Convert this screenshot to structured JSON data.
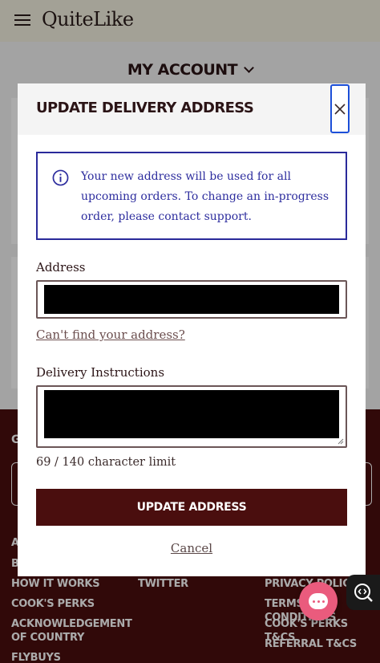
{
  "header": {
    "logo": "QuiteLike"
  },
  "account": {
    "title": "MY ACCOUNT"
  },
  "footer": {
    "newsletter_heading": "G",
    "col1": [
      "A",
      "B",
      "HOW IT WORKS",
      "COOK'S PERKS",
      "ACKNOWLEDGEMENT",
      "OF COUNTRY",
      "FLYBUYS"
    ],
    "col2": [
      "TWITTER"
    ],
    "col3": [
      "PRIVACY POLICY",
      "TERMS & CONDITIONS",
      "COOK'S PERKS T&CS",
      "REFERRAL T&CS"
    ]
  },
  "modal": {
    "title": "UPDATE DELIVERY ADDRESS",
    "close_icon": "close-icon",
    "info": {
      "icon": "info-icon",
      "text": "Your new address will be used for all upcoming orders. To change an in-progress order, please contact support."
    },
    "address": {
      "label": "Address",
      "value": "[redacted]"
    },
    "cant_find_link": "Can't find your address?",
    "instructions": {
      "label": "Delivery Instructions",
      "value": "[redacted]"
    },
    "char_limit": "69 / 140 character limit",
    "submit_label": "UPDATE ADDRESS",
    "cancel_label": "Cancel"
  },
  "widgets": {
    "chat_icon": "chat-icon",
    "accessibility_icon": "accessibility-icon"
  },
  "colors": {
    "brand_maroon": "#4a0e0e",
    "info_blue": "#2d2d9e",
    "focus_blue": "#1c4fd8",
    "chat_pink": "#ea5b7d"
  }
}
